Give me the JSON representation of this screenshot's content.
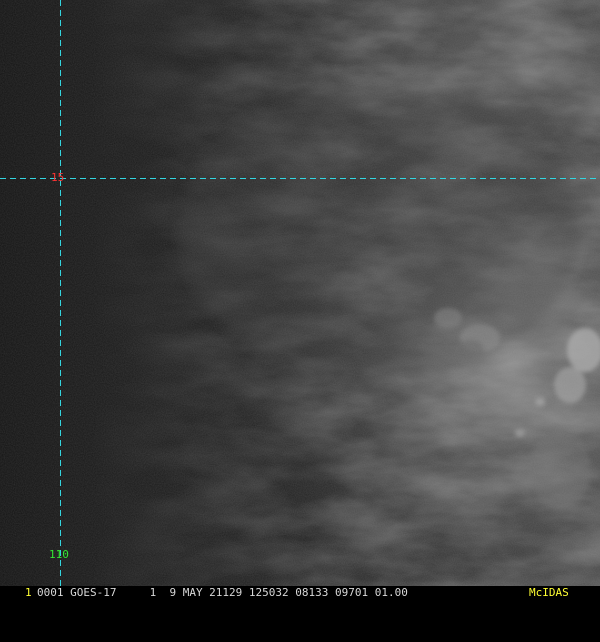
{
  "colors": {
    "grid_line": "#33d6e0",
    "lat_label": "#ff3333",
    "lon_label": "#33e633",
    "frame_number": "#ffff33",
    "status_text": "#d8d8d8",
    "brand": "#ffff33"
  },
  "grid": {
    "lat_label": "15",
    "lon_label": "110"
  },
  "status_bar": {
    "frame_number": "1",
    "text": "0001 GOES-17     1  9 MAY 21129 125032 08133 09701 01.00",
    "brand": "McIDAS"
  }
}
